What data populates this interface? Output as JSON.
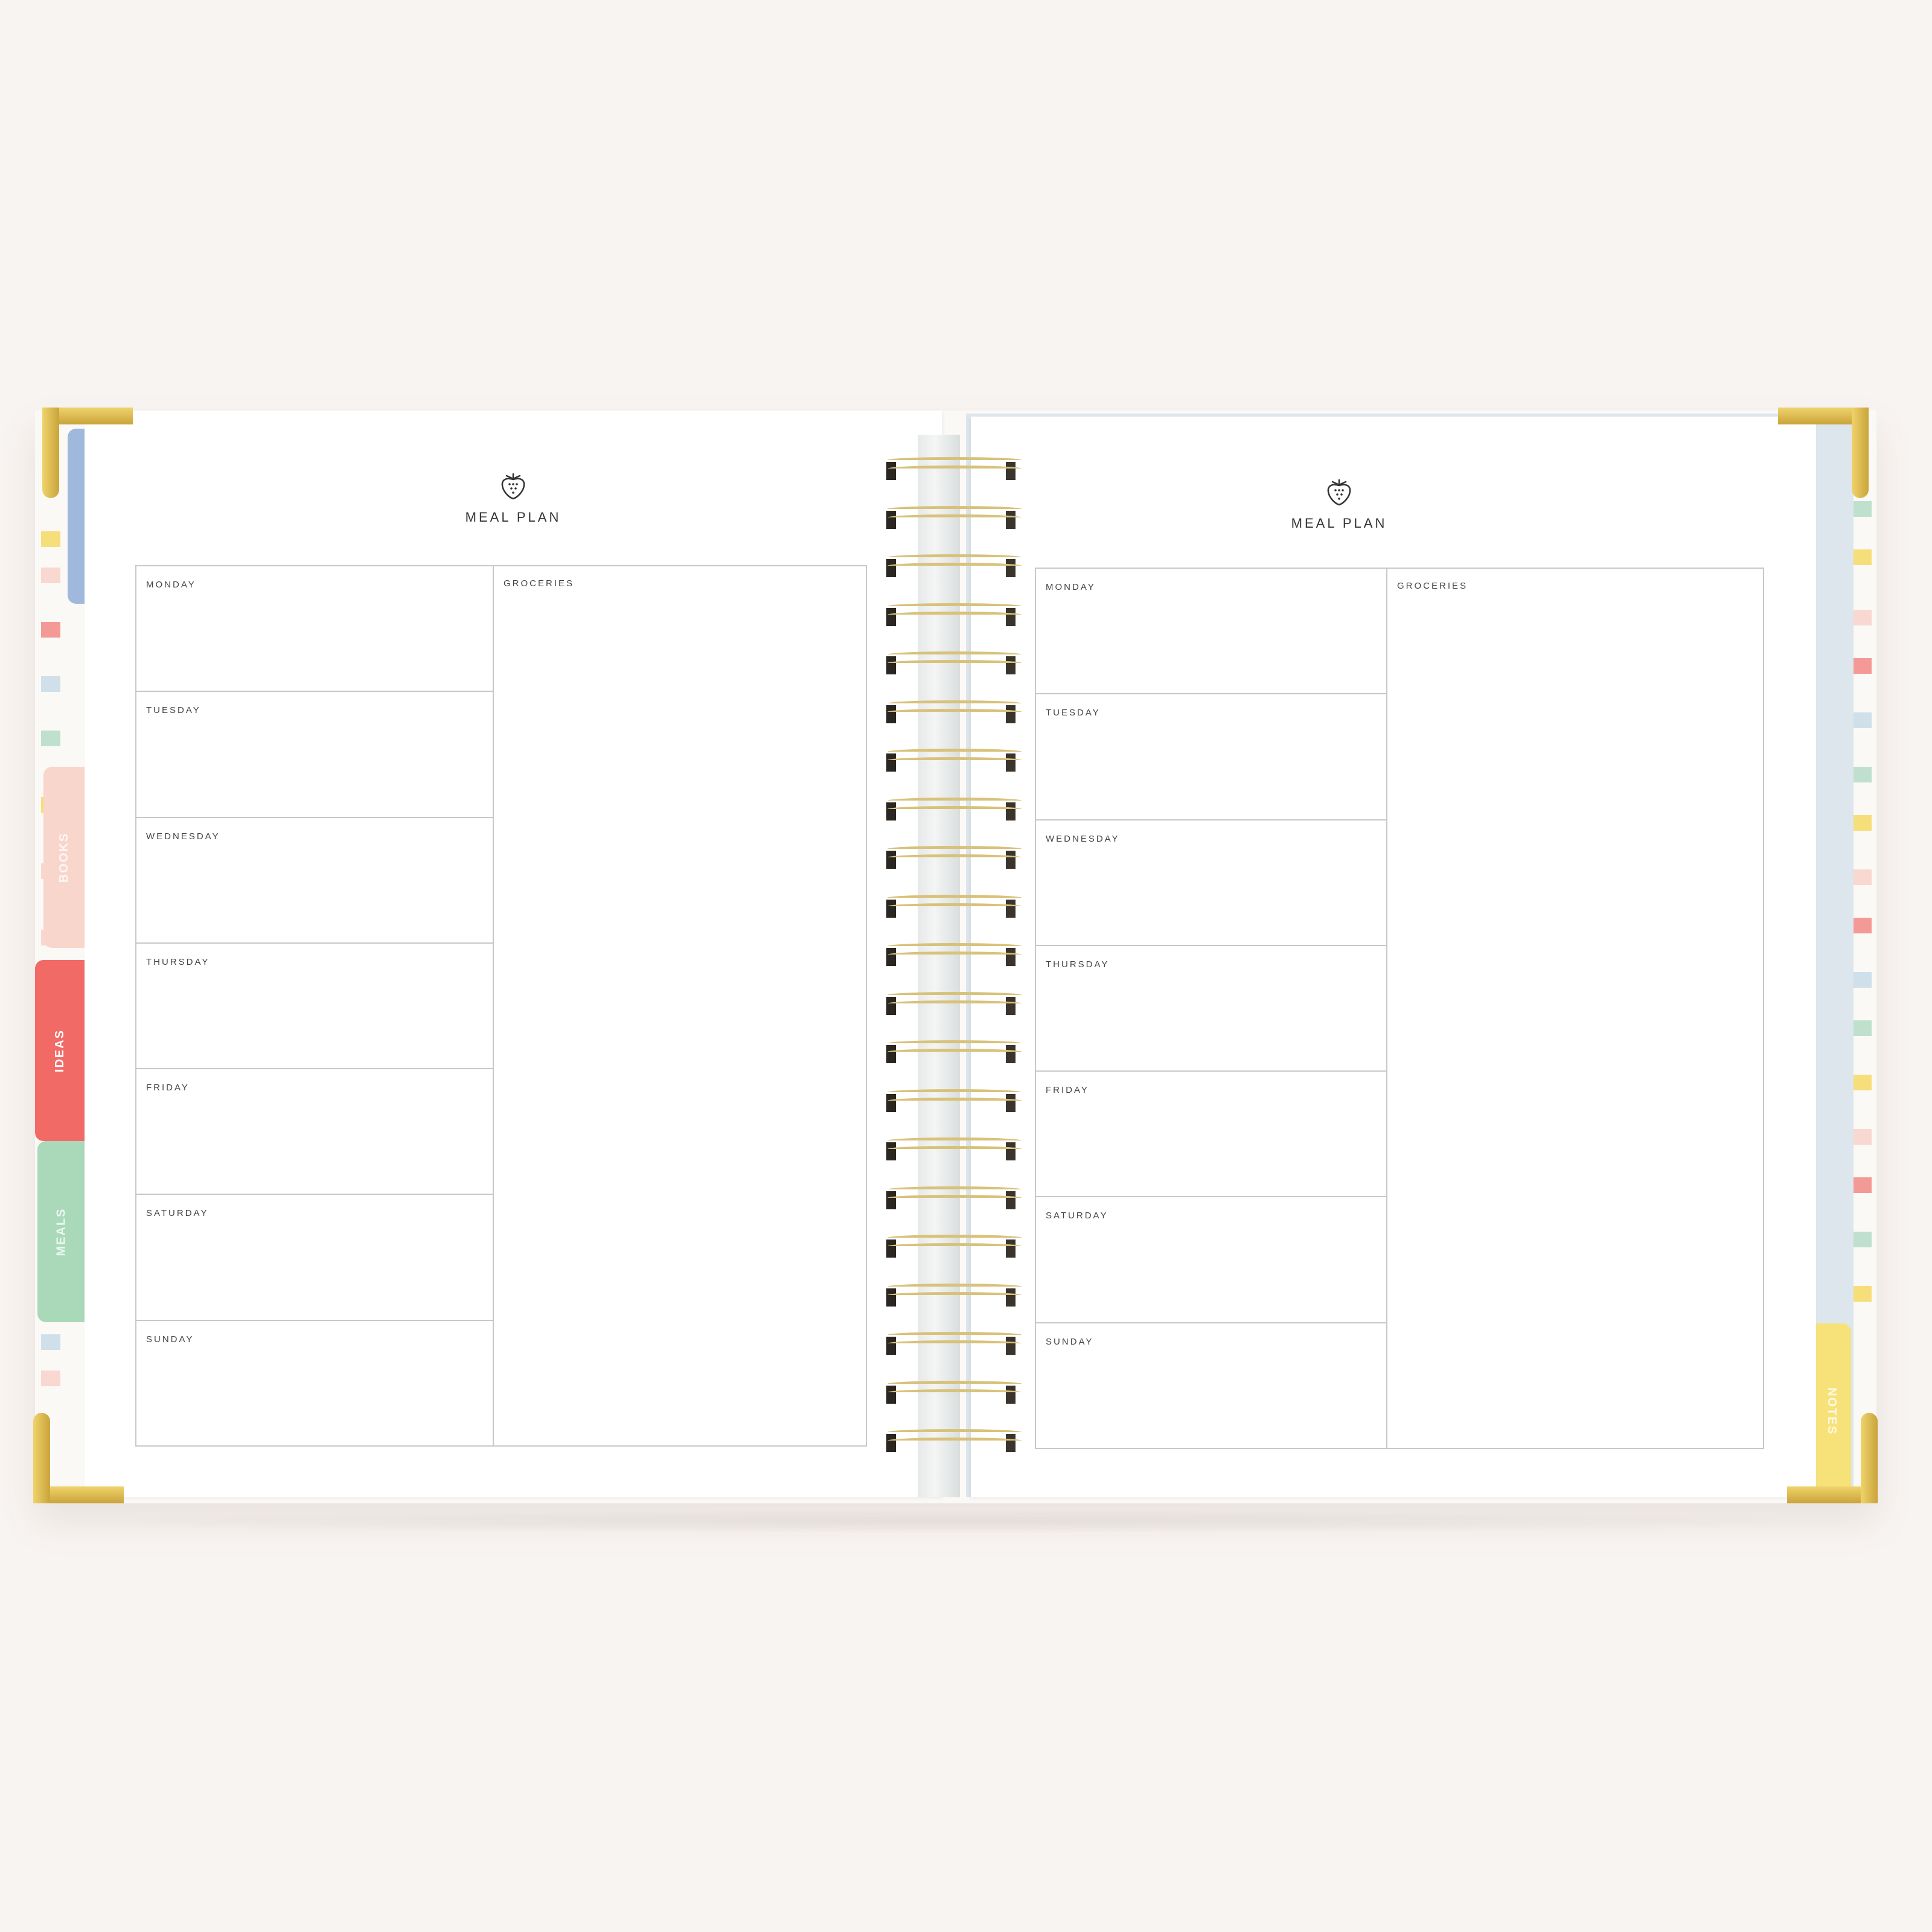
{
  "planner": {
    "left_page": {
      "icon": "strawberry-icon",
      "title": "MEAL PLAN",
      "days": [
        "MONDAY",
        "TUESDAY",
        "WEDNESDAY",
        "THURSDAY",
        "FRIDAY",
        "SATURDAY",
        "SUNDAY"
      ],
      "groceries_label": "GROCERIES"
    },
    "right_page": {
      "icon": "strawberry-icon",
      "title": "MEAL PLAN",
      "days": [
        "MONDAY",
        "TUESDAY",
        "WEDNESDAY",
        "THURSDAY",
        "FRIDAY",
        "SATURDAY",
        "SUNDAY"
      ],
      "groceries_label": "GROCERIES"
    },
    "tabs": [
      {
        "label": "",
        "color": "#9fb8dc"
      },
      {
        "label": "BOOKS",
        "color": "#f8d6cc"
      },
      {
        "label": "IDEAS",
        "color": "#f26a66"
      },
      {
        "label": "MEALS",
        "color": "#a9d9b8"
      },
      {
        "label": "NOTES",
        "color": "#f7e27a"
      }
    ],
    "colors": {
      "background": "#f8f4f1",
      "gold": "#d8c27a",
      "stripe_yellow": "#f6de7a",
      "stripe_pink": "#f8d8d0",
      "stripe_coral": "#f49a96",
      "stripe_mint": "#bfe0cd",
      "stripe_blue": "#cfe0ea"
    }
  }
}
